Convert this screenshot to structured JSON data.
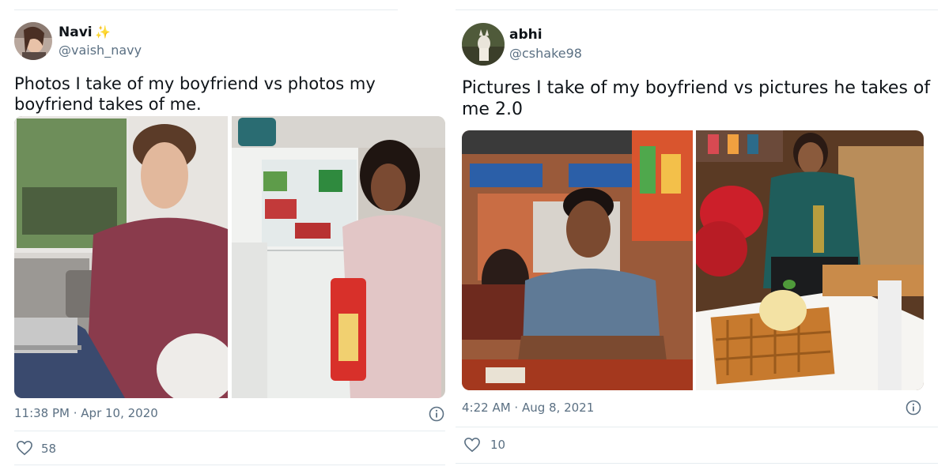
{
  "tweets": [
    {
      "name": "Navi",
      "name_emoji": "✨",
      "handle": "@vaish_navy",
      "text": "Photos I take of my boyfriend vs photos my boyfriend takes of me.",
      "timestamp": "11:38 PM · Apr 10, 2020",
      "likes": "58",
      "icons": {
        "info": "info-icon",
        "like": "heart-outline-icon"
      }
    },
    {
      "name": "abhi",
      "handle": "@cshake98",
      "text": "Pictures I take of my boyfriend vs pictures he takes of me 2.0",
      "timestamp": "4:22 AM · Aug 8, 2021",
      "likes": "10",
      "icons": {
        "info": "info-icon",
        "like": "heart-outline-icon"
      }
    }
  ],
  "colors": {
    "text_primary": "#0f1419",
    "text_secondary": "#5b7083",
    "border": "#e6ecf0"
  }
}
